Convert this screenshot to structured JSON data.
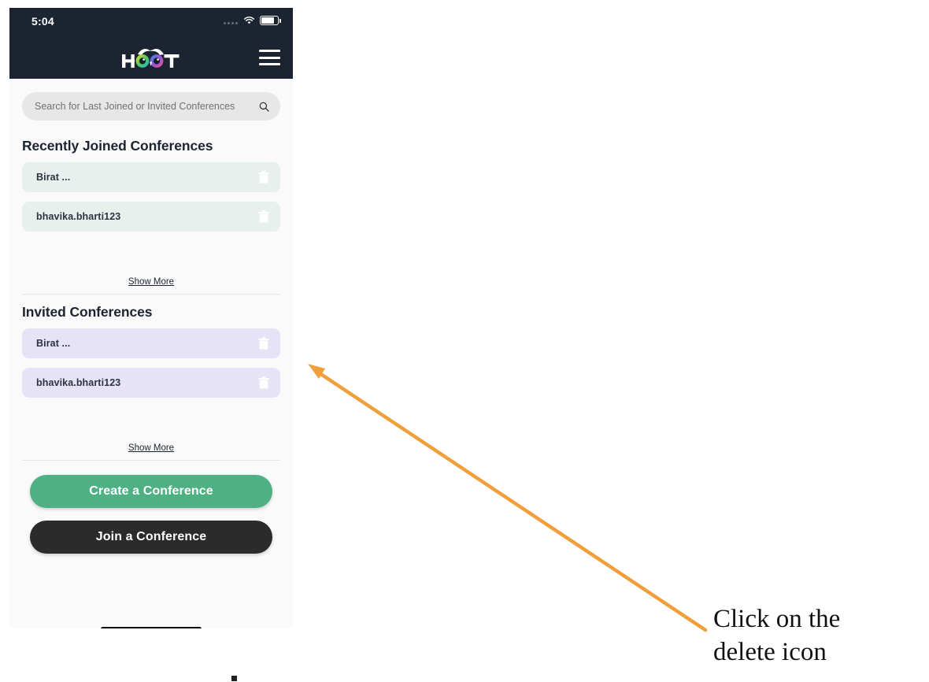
{
  "phone": {
    "status_bar": {
      "time": "5:04",
      "signal_icon": "signal-dots-icon",
      "wifi_icon": "wifi-icon",
      "battery_icon": "battery-icon"
    },
    "app_bar": {
      "logo_text": "HOOT",
      "logo_name": "hoot-logo",
      "menu_icon": "hamburger-menu-icon"
    },
    "search": {
      "value": "",
      "placeholder": "Search for Last Joined or Invited Conferences",
      "icon": "search-icon"
    },
    "recently_joined": {
      "title": "Recently Joined Conferences",
      "items": [
        {
          "name": "Birat ...",
          "delete_icon": "delete-icon"
        },
        {
          "name": "bhavika.bharti123",
          "delete_icon": "delete-icon"
        }
      ],
      "show_more": "Show More"
    },
    "invited": {
      "title": "Invited Conferences",
      "items": [
        {
          "name": "Birat ...",
          "delete_icon": "delete-icon"
        },
        {
          "name": "bhavika.bharti123",
          "delete_icon": "delete-icon"
        }
      ],
      "show_more": "Show More"
    },
    "actions": {
      "create_label": "Create a Conference",
      "join_label": "Join a Conference",
      "create_color": "#4fb183",
      "join_color": "#2b2b2b"
    }
  },
  "annotation": {
    "line1": "Click on the",
    "line2": "delete icon",
    "arrow_color": "#efa03c"
  },
  "colors": {
    "app_bar": "#1b2430",
    "page_bg": "#fafafa",
    "joined_item_bg": "#e8f0ee",
    "invited_item_bg": "#e7e3f6",
    "search_bg": "#e7e7e7"
  }
}
